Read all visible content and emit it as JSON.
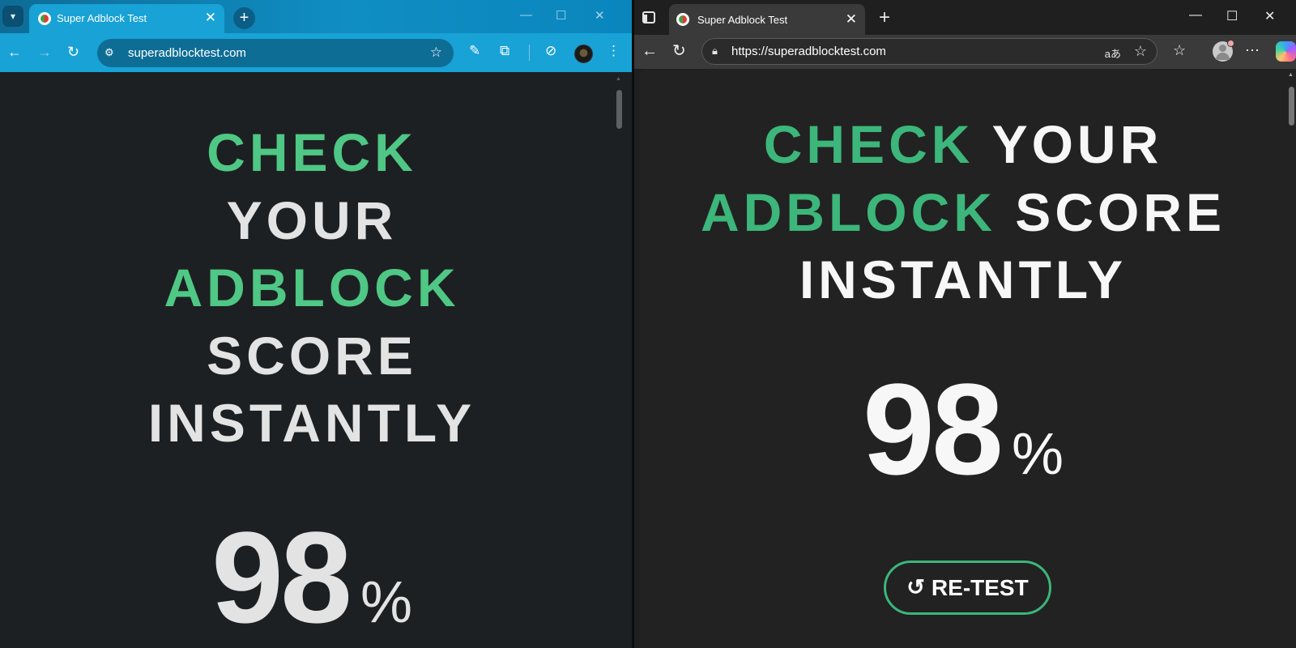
{
  "left_browser": {
    "tab_title": "Super Adblock Test",
    "tab_close": "✕",
    "new_tab": "+",
    "url": "superadblocktest.com",
    "window_controls": {
      "minimize": "—",
      "maximize": "☐",
      "close": "✕"
    },
    "page": {
      "headline": {
        "w1": "CHECK",
        "w2": "YOUR",
        "w3": "ADBLOCK",
        "w4": "SCORE",
        "w5": "INSTANTLY"
      },
      "score_value": "98",
      "score_unit": "%"
    }
  },
  "right_browser": {
    "tab_title": "Super Adblock Test",
    "tab_close": "✕",
    "new_tab": "+",
    "url": "https://superadblocktest.com",
    "read_aloud": "aあ",
    "window_controls": {
      "minimize": "—",
      "maximize": "☐",
      "close": "✕"
    },
    "page": {
      "headline": {
        "w1": "CHECK",
        "w2": "YOUR",
        "w3": "ADBLOCK",
        "w4": "SCORE",
        "w5": "INSTANTLY"
      },
      "score_value": "98",
      "score_unit": "%",
      "retest_label": "RE-TEST"
    }
  },
  "colors": {
    "accent_green_left": "#4fc785",
    "accent_green_right": "#3cb67a",
    "chrome_toolbar": "#18a2d6",
    "edge_toolbar": "#3a3a3a"
  },
  "icons": {
    "left": [
      "tab-search-icon",
      "favicon-icon",
      "close-icon",
      "plus-icon",
      "back-icon",
      "forward-icon",
      "reload-icon",
      "site-info-icon",
      "bookmark-star-icon",
      "eyedropper-icon",
      "extensions-icon",
      "performance-icon",
      "profile-avatar-icon",
      "menu-dots-icon"
    ],
    "right": [
      "vertical-tabs-icon",
      "favicon-icon",
      "close-icon",
      "plus-icon",
      "back-icon",
      "reload-icon",
      "lock-icon",
      "read-aloud-icon",
      "favorite-star-icon",
      "favorites-icon",
      "profile-icon",
      "more-icon",
      "copilot-icon",
      "refresh-icon"
    ]
  }
}
